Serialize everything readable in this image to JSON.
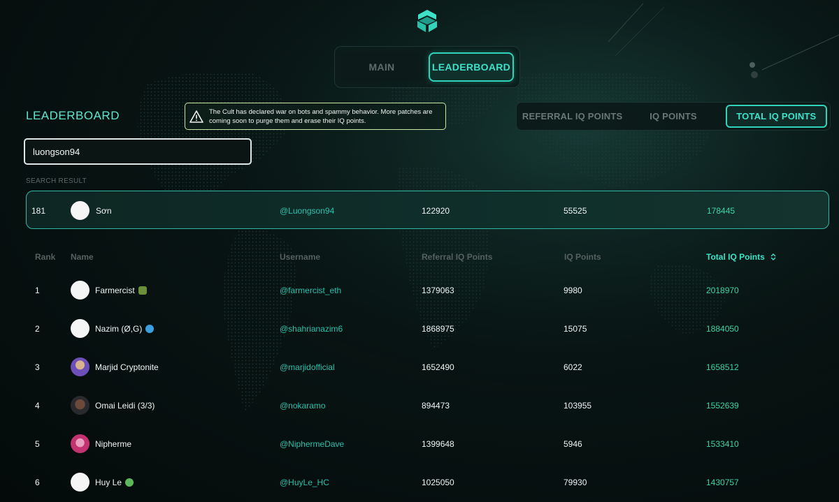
{
  "nav": {
    "tabs": [
      {
        "label": "MAIN",
        "active": false
      },
      {
        "label": "LEADERBOARD",
        "active": true
      }
    ]
  },
  "page_title": "LEADERBOARD",
  "notice": {
    "icon": "warning-icon",
    "text": "The Cult has declared war on bots and spammy behavior. More patches are coming soon to purge them and erase their IQ points."
  },
  "metric_tabs": [
    {
      "label": "REFERRAL IQ POINTS",
      "active": false
    },
    {
      "label": "IQ POINTS",
      "active": false
    },
    {
      "label": "TOTAL IQ POINTS",
      "active": true
    }
  ],
  "search": {
    "value": "luongson94"
  },
  "search_result": {
    "label": "SEARCH RESULT",
    "rank": "181",
    "name": "Sơn",
    "username": "@Luongson94",
    "referral_iq": "122920",
    "iq": "55525",
    "total_iq": "178445"
  },
  "table": {
    "headers": {
      "rank": "Rank",
      "name": "Name",
      "username": "Username",
      "referral": "Referral IQ Points",
      "iq": "IQ Points",
      "total": "Total IQ Points"
    },
    "rows": [
      {
        "rank": "1",
        "name": "Farmercist",
        "username": "@farmercist_eth",
        "referral": "1379063",
        "iq": "9980",
        "total": "2018970",
        "avatar": "placeholder",
        "emoji": "farmer"
      },
      {
        "rank": "2",
        "name": "Nazim (Ø,G)",
        "username": "@shahrianazim6",
        "referral": "1868975",
        "iq": "15075",
        "total": "1884050",
        "avatar": "placeholder",
        "emoji": "droplet"
      },
      {
        "rank": "3",
        "name": "Marjid Cryptonite",
        "username": "@marjidofficial",
        "referral": "1652490",
        "iq": "6022",
        "total": "1658512",
        "avatar": "photo",
        "emoji": ""
      },
      {
        "rank": "4",
        "name": "Omai Leidi (3/3)",
        "username": "@nokaramo",
        "referral": "894473",
        "iq": "103955",
        "total": "1552639",
        "avatar": "photo",
        "emoji": ""
      },
      {
        "rank": "5",
        "name": "Nipherme",
        "username": "@NiphermeDave",
        "referral": "1399648",
        "iq": "5946",
        "total": "1533410",
        "avatar": "photo",
        "emoji": ""
      },
      {
        "rank": "6",
        "name": "Huy Le",
        "username": "@HuyLe_HC",
        "referral": "1025050",
        "iq": "79930",
        "total": "1430757",
        "avatar": "placeholder",
        "emoji": "frog"
      }
    ]
  },
  "colors": {
    "accent": "#2fd3bc",
    "total_points": "#3bd5a6",
    "username": "#29c1ad"
  }
}
